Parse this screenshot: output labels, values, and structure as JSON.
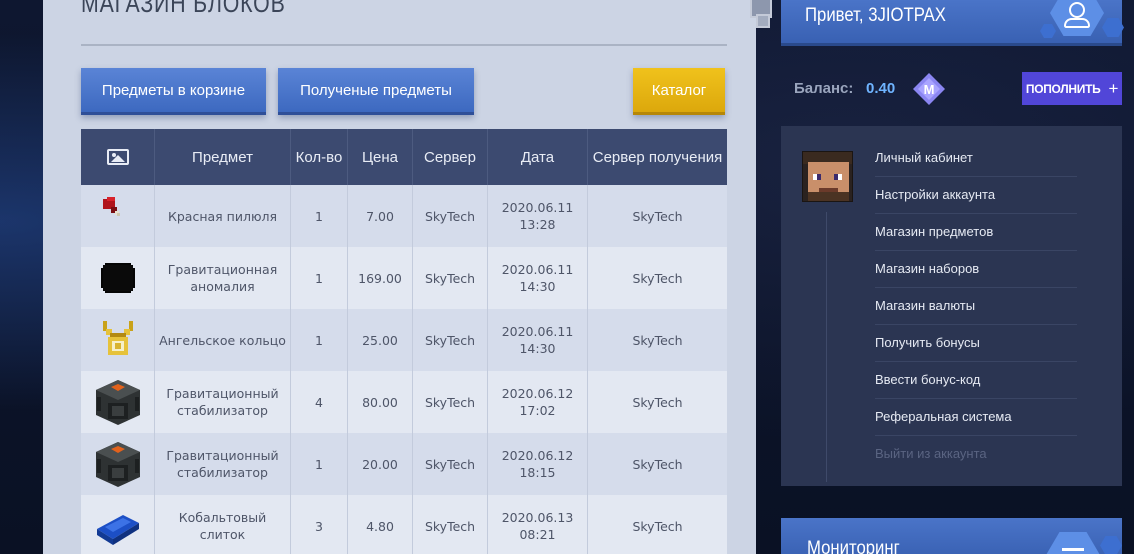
{
  "page_title": "Магазин блоков",
  "buttons": {
    "cart": "Предметы в корзине",
    "received": "Полученые предметы",
    "catalog": "Каталог"
  },
  "table": {
    "headers": [
      "",
      "Предмет",
      "Кол-во",
      "Цена",
      "Сервер",
      "Дата",
      "Сервер получения"
    ],
    "rows": [
      {
        "icon": "red-pill-icon",
        "item": "Красная пилюля",
        "qty": "1",
        "price": "7.00",
        "server": "SkyTech",
        "date": "2020.06.11",
        "time": "13:28",
        "receive_server": "SkyTech"
      },
      {
        "icon": "gravity-anomaly-icon",
        "item": "Гравитационная аномалия",
        "qty": "1",
        "price": "169.00",
        "server": "SkyTech",
        "date": "2020.06.11",
        "time": "14:30",
        "receive_server": "SkyTech"
      },
      {
        "icon": "angel-ring-icon",
        "item": "Ангельское кольцо",
        "qty": "1",
        "price": "25.00",
        "server": "SkyTech",
        "date": "2020.06.11",
        "time": "14:30",
        "receive_server": "SkyTech"
      },
      {
        "icon": "gravity-stabilizer-icon",
        "item": "Гравитационный стабилизатор",
        "qty": "4",
        "price": "80.00",
        "server": "SkyTech",
        "date": "2020.06.12",
        "time": "17:02",
        "receive_server": "SkyTech"
      },
      {
        "icon": "gravity-stabilizer-icon",
        "item": "Гравитационный стабилизатор",
        "qty": "1",
        "price": "20.00",
        "server": "SkyTech",
        "date": "2020.06.12",
        "time": "18:15",
        "receive_server": "SkyTech"
      },
      {
        "icon": "cobalt-ingot-icon",
        "item": "Кобальтовый слиток",
        "qty": "3",
        "price": "4.80",
        "server": "SkyTech",
        "date": "2020.06.13",
        "time": "08:21",
        "receive_server": "SkyTech"
      }
    ]
  },
  "user": {
    "greeting": "Привет, 3JIOTPAX",
    "balance_label": "Баланс:",
    "balance_value": "0.40",
    "topup_label": "ПОПОЛНИТЬ"
  },
  "menu": {
    "items": [
      "Личный кабинет",
      "Настройки аккаунта",
      "Магазин предметов",
      "Магазин наборов",
      "Магазин валюты",
      "Получить бонусы",
      "Ввести бонус-код",
      "Реферальная система"
    ],
    "logout": "Выйти из аккаунта"
  },
  "monitoring": {
    "title": "Мониторинг"
  },
  "colors": {
    "accent_blue": "#3d69c0",
    "catalog_yellow": "#dca80c",
    "topup_purple": "#5146d8",
    "balance_blue": "#6fb4ff"
  }
}
